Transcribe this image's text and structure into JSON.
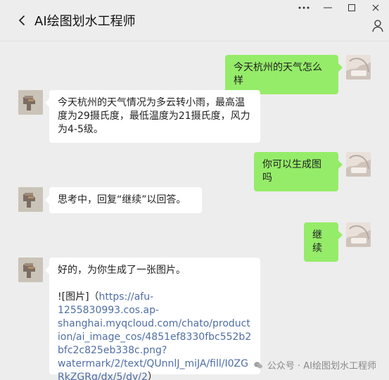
{
  "window": {
    "title": "AI绘图划水工程师",
    "controls": {
      "more_icon": "more-horizontal-icon",
      "minimize_icon": "minimize-icon",
      "maximize_icon": "maximize-icon",
      "close_icon": "close-icon"
    }
  },
  "header": {
    "back_icon": "chevron-left-icon",
    "profile_icon": "person-icon"
  },
  "messages": [
    {
      "side": "right",
      "text": "今天杭州的天气怎么样"
    },
    {
      "side": "left",
      "text": "今天杭州的天气情况为多云转小雨，最高温度为29摄氏度，最低温度为21摄氏度，风力为4-5级。"
    },
    {
      "side": "right",
      "text": "你可以生成图吗"
    },
    {
      "side": "left",
      "text": "思考中，回复“继续”以回答。"
    },
    {
      "side": "right",
      "text": "继续"
    },
    {
      "side": "left",
      "line1": "好的，为你生成了一张图片。",
      "prefix": "![图片]（",
      "link": "https://afu-1255830993.cos.ap-shanghai.myqcloud.com/chato/production/ai_image_cos/4851ef8330fbc552b2bfc2c825eb338c.png?watermark/2/text/QUnnlJ_miJA/fill/I0ZGRkZGRg/dx/5/dy/2",
      "suffix": "）"
    }
  ],
  "watermark": {
    "text": "公众号 · AI绘图划水工程师",
    "icon": "wechat-icon"
  },
  "colors": {
    "background": "#ededed",
    "sent_bubble": "#95ec69",
    "received_bubble": "#ffffff",
    "link": "#4f6ea5"
  }
}
